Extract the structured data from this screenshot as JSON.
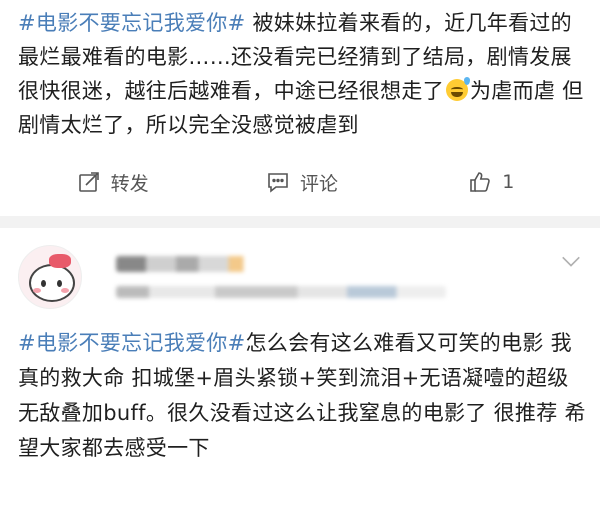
{
  "post": {
    "hashtag": "#电影不要忘记我爱你#",
    "text_before_emoji": " 被妹妹拉着来看的，近几年看过的最烂最难看的电影……还没看完已经猜到了结局，剧情发展很快很迷，越往后越难看，中途已经很想走了",
    "emoji": "sweat-smile-emoji",
    "text_after_emoji": "为虐而虐 但剧情太烂了，所以完全没感觉被虐到"
  },
  "actions": {
    "repost_label": "转发",
    "comment_label": "评论",
    "like_count": "1",
    "repost_icon": "share-icon",
    "comment_icon": "comment-icon",
    "like_icon": "thumbs-up-icon"
  },
  "comment": {
    "hashtag": "#电影不要忘记我爱你#",
    "text": "怎么会有这么难看又可笑的电影 我真的救大命 扣城堡+眉头紧锁+笑到流泪+无语凝噎的超级无敌叠加buff。很久没看过这么让我窒息的电影了 很推荐 希望大家都去感受一下",
    "more_icon": "chevron-down-icon"
  },
  "colors": {
    "hashtag": "#4a7eb8",
    "text": "#1f1f1f",
    "divider": "#f2f2f2"
  }
}
